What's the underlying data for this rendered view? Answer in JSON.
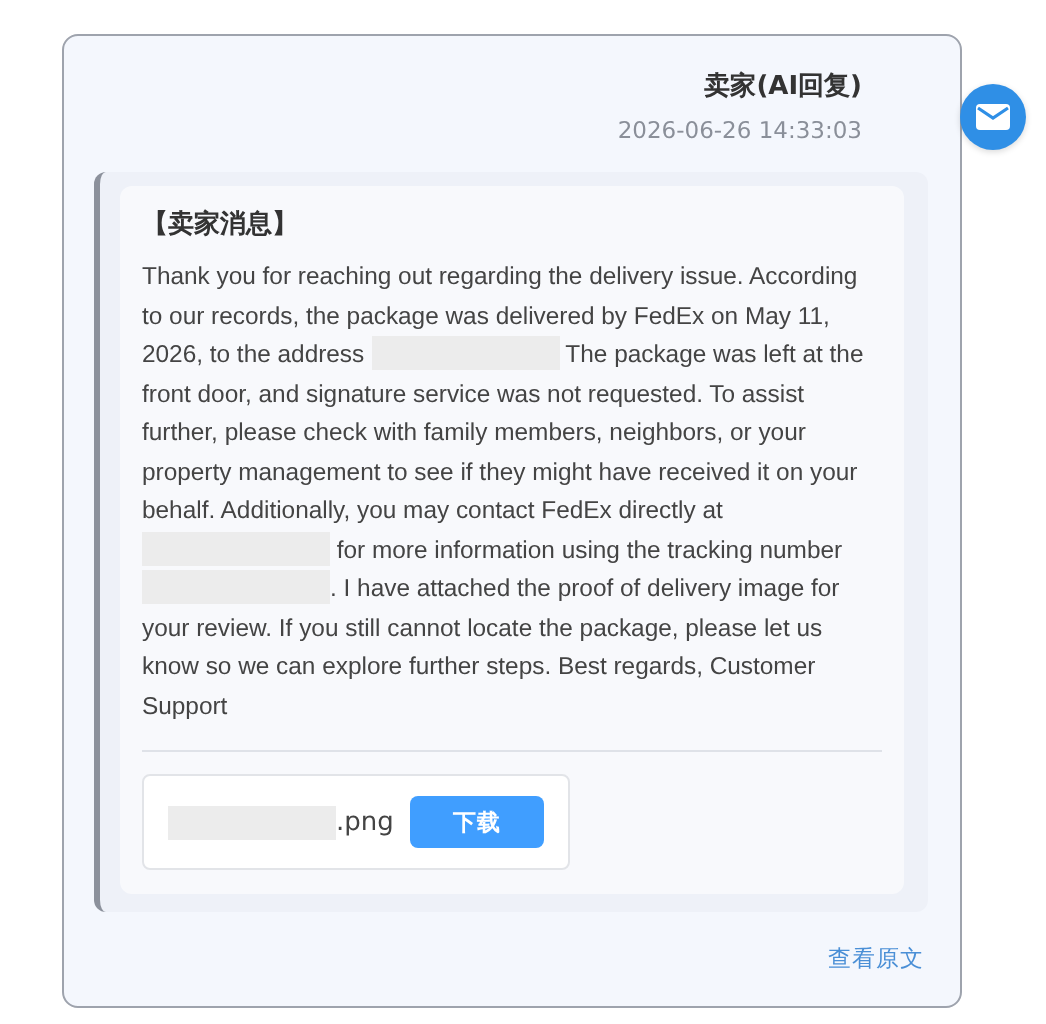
{
  "message": {
    "sender": "卖家(AI回复)",
    "time": "2026-06-26 14:33:03",
    "heading": "【卖家消息】",
    "body": [
      {
        "kind": "text",
        "text": "Thank you for reaching out regarding the delivery issue. According to our records, the package was delivered by FedEx on May 11, 2026, to the address "
      },
      {
        "kind": "redacted"
      },
      {
        "kind": "text",
        "text": " The package was left at the front door, and signature service was not requested. To assist further, please check with family members, neighbors, or your property management to see if they might have received it on your behalf. Additionally, you may contact FedEx directly at "
      },
      {
        "kind": "redacted"
      },
      {
        "kind": "text",
        "text": " for more information using the tracking number "
      },
      {
        "kind": "redacted"
      },
      {
        "kind": "text",
        "text": ". I have attached the proof of delivery image for your review. If you still cannot locate the package, please let us know so we can explore further steps. Best regards, Customer Support"
      }
    ],
    "attachment": {
      "extension": ".png",
      "button": "下载"
    },
    "view_original": "查看原文"
  }
}
